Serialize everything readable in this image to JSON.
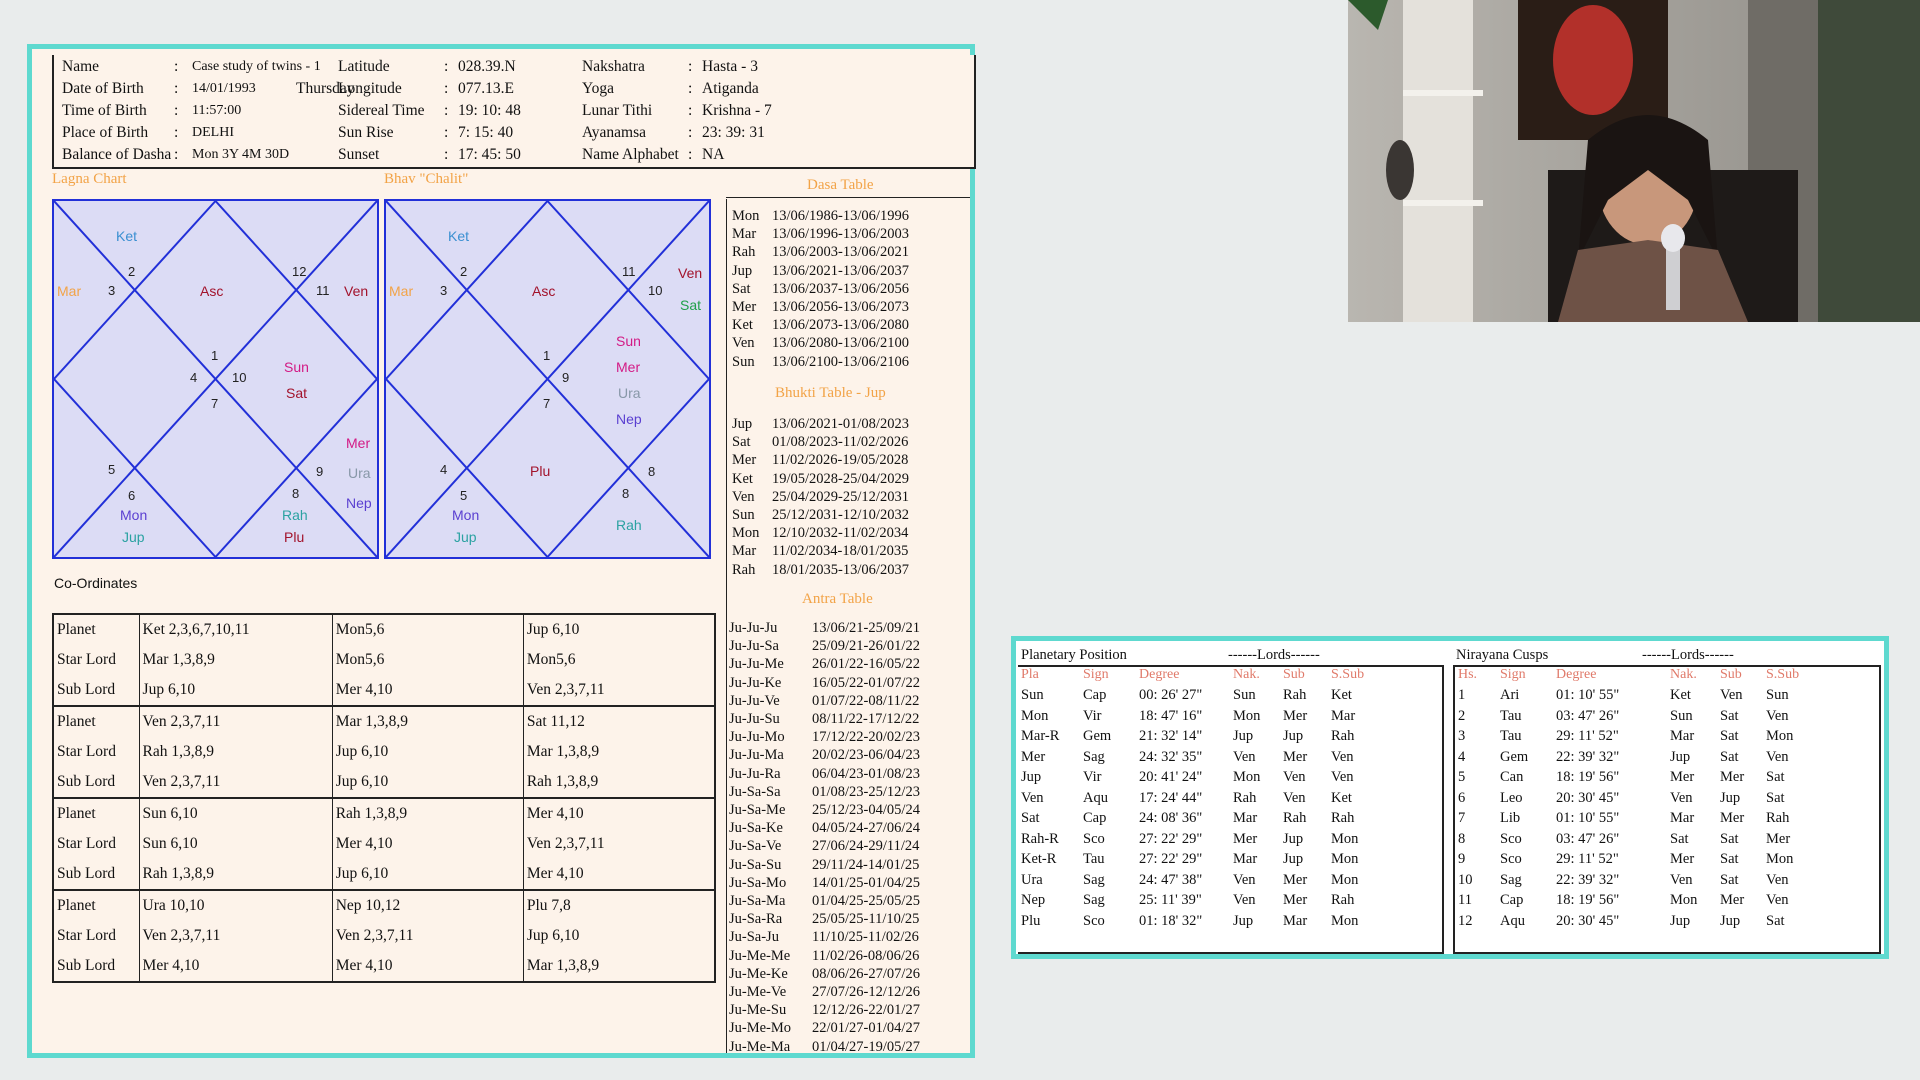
{
  "header": {
    "left": [
      {
        "k": "Name",
        "v": "Case study of twins - 1"
      },
      {
        "k": "Date of Birth",
        "v": "14/01/1993",
        "v2": "Thursday"
      },
      {
        "k": "Time of Birth",
        "v": "11:57:00"
      },
      {
        "k": "Place of Birth",
        "v": "DELHI"
      },
      {
        "k": "Balance of Dasha",
        "v": "Mon 3Y 4M 30D"
      }
    ],
    "mid": [
      {
        "k": "Latitude",
        "v": "028.39.N"
      },
      {
        "k": "Longitude",
        "v": "077.13.E"
      },
      {
        "k": "Sidereal Time",
        "v": "19: 10: 48"
      },
      {
        "k": "Sun Rise",
        "v": "7: 15: 40"
      },
      {
        "k": "Sunset",
        "v": "17: 45: 50"
      }
    ],
    "right": [
      {
        "k": "Nakshatra",
        "v": "Hasta - 3"
      },
      {
        "k": "Yoga",
        "v": "Atiganda"
      },
      {
        "k": "Lunar Tithi",
        "v": "Krishna - 7"
      },
      {
        "k": "Ayanamsa",
        "v": "23: 39: 31"
      },
      {
        "k": "Name Alphabet",
        "v": "NA"
      }
    ],
    "colon": ":"
  },
  "lagna": {
    "title": "Lagna Chart",
    "labels": [
      "Ket",
      "Mar",
      "Asc",
      "Ven",
      "Sun",
      "Sat",
      "Mer",
      "Ura",
      "Nep",
      "Mon",
      "Jup",
      "Rah",
      "Plu"
    ],
    "nums": [
      "2",
      "3",
      "12",
      "11",
      "1",
      "4",
      "10",
      "7",
      "5",
      "6",
      "9",
      "8"
    ]
  },
  "bhav": {
    "title": "Bhav \"Chalit\"",
    "labels": [
      "Ket",
      "Mar",
      "Asc",
      "Ven",
      "Sat",
      "Sun",
      "Mer",
      "Ura",
      "Nep",
      "Plu",
      "Mon",
      "Jup",
      "Rah"
    ],
    "nums": [
      "2",
      "3",
      "11",
      "10",
      "1",
      "9",
      "7",
      "4",
      "5",
      "8",
      "8"
    ]
  },
  "coord_title": "Co-Ordinates",
  "coord_rows": [
    [
      "Planet",
      "Ket  2,3,6,7,10,11",
      "Mon5,6",
      "Jup  6,10"
    ],
    [
      "Star Lord",
      "Mar  1,3,8,9",
      "Mon5,6",
      "Mon5,6"
    ],
    [
      "Sub Lord",
      "Jup  6,10",
      "Mer  4,10",
      "Ven  2,3,7,11"
    ],
    [
      "Planet",
      "Ven  2,3,7,11",
      "Mar  1,3,8,9",
      "Sat  11,12"
    ],
    [
      "Star Lord",
      "Rah  1,3,8,9",
      "Jup  6,10",
      "Mar  1,3,8,9"
    ],
    [
      "Sub Lord",
      "Ven  2,3,7,11",
      "Jup  6,10",
      "Rah  1,3,8,9"
    ],
    [
      "Planet",
      "Sun  6,10",
      "Rah  1,3,8,9",
      "Mer  4,10"
    ],
    [
      "Star Lord",
      "Sun  6,10",
      "Mer  4,10",
      "Ven  2,3,7,11"
    ],
    [
      "Sub Lord",
      "Rah  1,3,8,9",
      "Jup  6,10",
      "Mer  4,10"
    ],
    [
      "Planet",
      "Ura  10,10",
      "Nep  10,12",
      "Plu  7,8"
    ],
    [
      "Star Lord",
      "Ven  2,3,7,11",
      "Ven  2,3,7,11",
      "Jup  6,10"
    ],
    [
      "Sub Lord",
      "Mer  4,10",
      "Mer  4,10",
      "Mar  1,3,8,9"
    ]
  ],
  "dasa": {
    "title": "Dasa Table",
    "rows": [
      [
        "Mon",
        "13/06/1986-13/06/1996"
      ],
      [
        "Mar",
        "13/06/1996-13/06/2003"
      ],
      [
        "Rah",
        "13/06/2003-13/06/2021"
      ],
      [
        "Jup",
        "13/06/2021-13/06/2037"
      ],
      [
        "Sat",
        "13/06/2037-13/06/2056"
      ],
      [
        "Mer",
        "13/06/2056-13/06/2073"
      ],
      [
        "Ket",
        "13/06/2073-13/06/2080"
      ],
      [
        "Ven",
        "13/06/2080-13/06/2100"
      ],
      [
        "Sun",
        "13/06/2100-13/06/2106"
      ]
    ]
  },
  "bhukti": {
    "title": "Bhukti Table  -  Jup",
    "rows": [
      [
        "Jup",
        "13/06/2021-01/08/2023"
      ],
      [
        "Sat",
        "01/08/2023-11/02/2026"
      ],
      [
        "Mer",
        "11/02/2026-19/05/2028"
      ],
      [
        "Ket",
        "19/05/2028-25/04/2029"
      ],
      [
        "Ven",
        "25/04/2029-25/12/2031"
      ],
      [
        "Sun",
        "25/12/2031-12/10/2032"
      ],
      [
        "Mon",
        "12/10/2032-11/02/2034"
      ],
      [
        "Mar",
        "11/02/2034-18/01/2035"
      ],
      [
        "Rah",
        "18/01/2035-13/06/2037"
      ]
    ]
  },
  "antra": {
    "title": "Antra Table",
    "rows": [
      [
        "Ju-Ju-Ju",
        "13/06/21-25/09/21"
      ],
      [
        "Ju-Ju-Sa",
        "25/09/21-26/01/22"
      ],
      [
        "Ju-Ju-Me",
        "26/01/22-16/05/22"
      ],
      [
        "Ju-Ju-Ke",
        "16/05/22-01/07/22"
      ],
      [
        "Ju-Ju-Ve",
        "01/07/22-08/11/22"
      ],
      [
        "Ju-Ju-Su",
        "08/11/22-17/12/22"
      ],
      [
        "Ju-Ju-Mo",
        "17/12/22-20/02/23"
      ],
      [
        "Ju-Ju-Ma",
        "20/02/23-06/04/23"
      ],
      [
        "Ju-Ju-Ra",
        "06/04/23-01/08/23"
      ],
      [
        "Ju-Sa-Sa",
        "01/08/23-25/12/23"
      ],
      [
        "Ju-Sa-Me",
        "25/12/23-04/05/24"
      ],
      [
        "Ju-Sa-Ke",
        "04/05/24-27/06/24"
      ],
      [
        "Ju-Sa-Ve",
        "27/06/24-29/11/24"
      ],
      [
        "Ju-Sa-Su",
        "29/11/24-14/01/25"
      ],
      [
        "Ju-Sa-Mo",
        "14/01/25-01/04/25"
      ],
      [
        "Ju-Sa-Ma",
        "01/04/25-25/05/25"
      ],
      [
        "Ju-Sa-Ra",
        "25/05/25-11/10/25"
      ],
      [
        "Ju-Sa-Ju",
        "11/10/25-11/02/26"
      ],
      [
        "Ju-Me-Me",
        "11/02/26-08/06/26"
      ],
      [
        "Ju-Me-Ke",
        "08/06/26-27/07/26"
      ],
      [
        "Ju-Me-Ve",
        "27/07/26-12/12/26"
      ],
      [
        "Ju-Me-Su",
        "12/12/26-22/01/27"
      ],
      [
        "Ju-Me-Mo",
        "22/01/27-01/04/27"
      ],
      [
        "Ju-Me-Ma",
        "01/04/27-19/05/27"
      ]
    ]
  },
  "planetary": {
    "title": "Planetary Position",
    "lords_title": "------Lords------",
    "headers": [
      "Pla",
      "Sign",
      "Degree",
      "Nak.",
      "Sub",
      "S.Sub"
    ],
    "rows": [
      [
        "Sun",
        "Cap",
        "00: 26' 27\"",
        "Sun",
        "Rah",
        "Ket"
      ],
      [
        "Mon",
        "Vir",
        "18: 47' 16\"",
        "Mon",
        "Mer",
        "Mar"
      ],
      [
        "Mar-R",
        "Gem",
        "21: 32' 14\"",
        "Jup",
        "Jup",
        "Rah"
      ],
      [
        "Mer",
        "Sag",
        "24: 32' 35\"",
        "Ven",
        "Mer",
        "Ven"
      ],
      [
        "Jup",
        "Vir",
        "20: 41' 24\"",
        "Mon",
        "Ven",
        "Ven"
      ],
      [
        "Ven",
        "Aqu",
        "17: 24' 44\"",
        "Rah",
        "Ven",
        "Ket"
      ],
      [
        "Sat",
        "Cap",
        "24: 08' 36\"",
        "Mar",
        "Rah",
        "Rah"
      ],
      [
        "Rah-R",
        "Sco",
        "27: 22' 29\"",
        "Mer",
        "Jup",
        "Mon"
      ],
      [
        "Ket-R",
        "Tau",
        "27: 22' 29\"",
        "Mar",
        "Jup",
        "Mon"
      ],
      [
        "Ura",
        "Sag",
        "24: 47' 38\"",
        "Ven",
        "Mer",
        "Mon"
      ],
      [
        "Nep",
        "Sag",
        "25: 11' 39\"",
        "Ven",
        "Mer",
        "Rah"
      ],
      [
        "Plu",
        "Sco",
        "01: 18' 32\"",
        "Jup",
        "Mar",
        "Mon"
      ]
    ]
  },
  "cusps": {
    "title": "Nirayana Cusps",
    "lords_title": "------Lords------",
    "headers": [
      "Hs.",
      "Sign",
      "Degree",
      "Nak.",
      "Sub",
      "S.Sub"
    ],
    "rows": [
      [
        "1",
        "Ari",
        "01: 10' 55\"",
        "Ket",
        "Ven",
        "Sun"
      ],
      [
        "2",
        "Tau",
        "03: 47' 26\"",
        "Sun",
        "Sat",
        "Ven"
      ],
      [
        "3",
        "Tau",
        "29: 11' 52\"",
        "Mar",
        "Sat",
        "Mon"
      ],
      [
        "4",
        "Gem",
        "22: 39' 32\"",
        "Jup",
        "Sat",
        "Ven"
      ],
      [
        "5",
        "Can",
        "18: 19' 56\"",
        "Mer",
        "Mer",
        "Sat"
      ],
      [
        "6",
        "Leo",
        "20: 30' 45\"",
        "Ven",
        "Jup",
        "Sat"
      ],
      [
        "7",
        "Lib",
        "01: 10' 55\"",
        "Mar",
        "Mer",
        "Rah"
      ],
      [
        "8",
        "Sco",
        "03: 47' 26\"",
        "Sat",
        "Sat",
        "Mer"
      ],
      [
        "9",
        "Sco",
        "29: 11' 52\"",
        "Mer",
        "Sat",
        "Mon"
      ],
      [
        "10",
        "Sag",
        "22: 39' 32\"",
        "Ven",
        "Sat",
        "Ven"
      ],
      [
        "11",
        "Cap",
        "18: 19' 56\"",
        "Mon",
        "Mer",
        "Ven"
      ],
      [
        "12",
        "Aqu",
        "20: 30' 45\"",
        "Jup",
        "Jup",
        "Sat"
      ]
    ]
  },
  "colors": {
    "accent_border": "#5ed9cf",
    "chart_line": "#2230d8",
    "chart_bg": "#dcdcf5",
    "title_orange": "#f2a347"
  }
}
